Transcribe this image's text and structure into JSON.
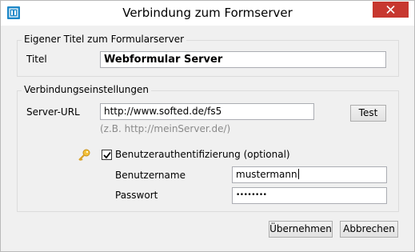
{
  "window": {
    "title": "Verbindung zum Formserver",
    "close_icon": "close-icon",
    "app_icon": "formserver-app-icon"
  },
  "title_group": {
    "legend": "Eigener Titel zum Formularserver",
    "title_label": "Titel",
    "title_value": "Webformular Server"
  },
  "connection_group": {
    "legend": "Verbindungseinstellungen",
    "url_label": "Server-URL",
    "url_value": "http://www.softed.de/fs5",
    "url_hint": "(z.B. http://meinServer.de/)",
    "test_label": "Test",
    "auth_icon": "key-icon",
    "auth_label": "Benutzerauthentifizierung (optional)",
    "auth_checked": true,
    "username_label": "Benutzername",
    "username_value": "mustermann",
    "password_label": "Passwort",
    "password_value": "••••••••"
  },
  "footer": {
    "ok_label": "Übernehmen",
    "cancel_label": "Abbrechen"
  },
  "colors": {
    "close_button": "#c7372f",
    "app_icon": "#1e88c8",
    "window_bg": "#f0f0f0"
  }
}
